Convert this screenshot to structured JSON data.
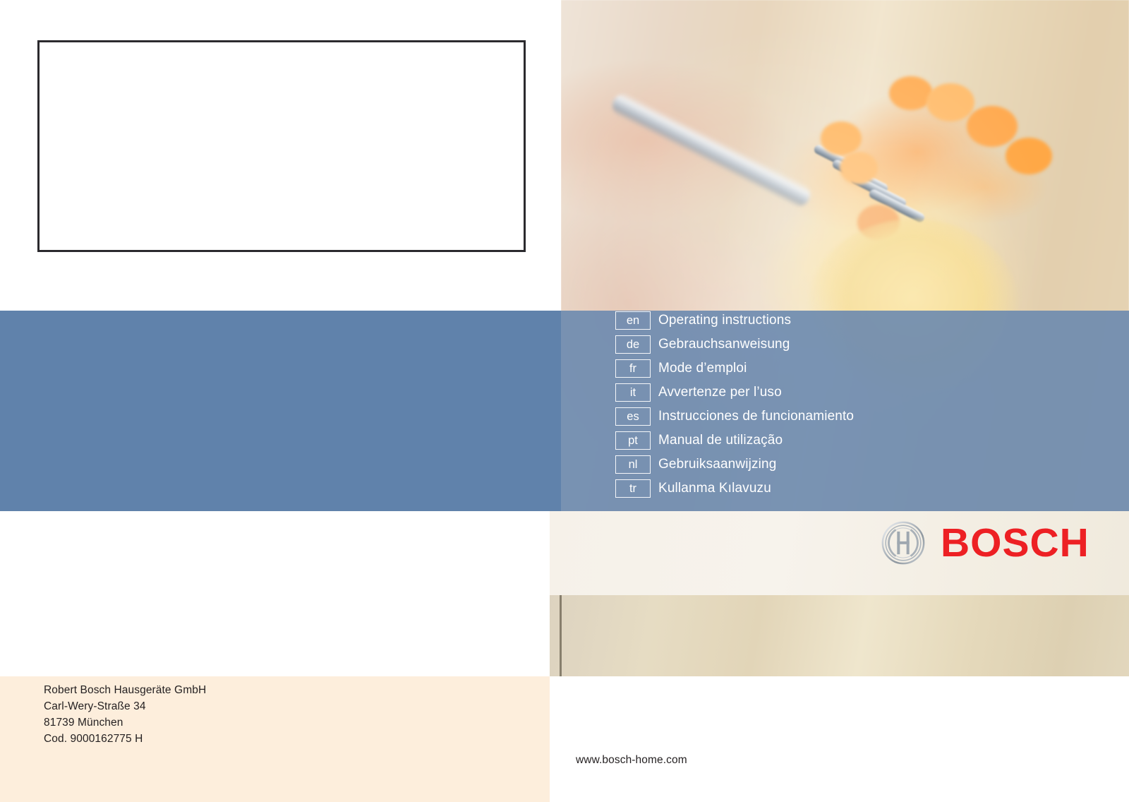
{
  "document": {
    "brand": "BOSCH",
    "accent_color": "#ed2024",
    "band_color": "#6082ab",
    "cream_color": "#fdeedc"
  },
  "languages": [
    {
      "code": "en",
      "title": "Operating  instructions"
    },
    {
      "code": "de",
      "title": "Gebrauchsanweisung"
    },
    {
      "code": "fr",
      "title": "Mode d’emploi"
    },
    {
      "code": "it",
      "title": "Avvertenze per l’uso"
    },
    {
      "code": "es",
      "title": "Instrucciones de funcionamiento"
    },
    {
      "code": "pt",
      "title": "Manual de utilização"
    },
    {
      "code": "nl",
      "title": "Gebruiksaanwijzing"
    },
    {
      "code": "tr",
      "title": "Kullanma Kılavuzu"
    }
  ],
  "address": {
    "line1": "Robert Bosch Hausgeräte GmbH",
    "line2": "Carl-Wery-Straße 34",
    "line3": "81739 München",
    "line4": "Cod. 9000162775 H"
  },
  "footer": {
    "website": "www.bosch-home.com"
  },
  "logo": {
    "wordmark": "BOSCH"
  },
  "photo": {
    "description": "blurred close-up photograph of a fork twirled with spaghetti in tomato sauce held toward a person's mouth"
  }
}
